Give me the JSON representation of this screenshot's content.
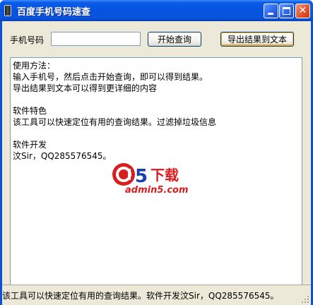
{
  "window": {
    "title": "百度手机号码速查",
    "minimize_icon": "minimize-icon",
    "maximize_icon": "maximize-icon",
    "close_icon": "close-icon",
    "close_glyph": "✕"
  },
  "form": {
    "phone_label": "手机号码",
    "phone_value": "",
    "start_button": "开始查询",
    "export_button": "导出结果到文本"
  },
  "results": {
    "lines": [
      "使用方法：",
      "输入手机号，然后点击开始查询，即可以得到结果。",
      "导出结果到文本可以得到更详细的内容",
      "",
      "软件特色",
      "该工具可以快速定位有用的查询结果。过滤掉垃圾信息",
      "",
      "软件开发",
      "汶Sir，QQ285576545。"
    ]
  },
  "watermark": {
    "logo": "a5",
    "text": "下载",
    "site": "admin5.com",
    "colors": {
      "red": "#d81e1e",
      "blue": "#1c3fae"
    }
  },
  "status": {
    "text": "该工具可以快速定位有用的查询结果。软件开发汶Sir，QQ285576545。"
  },
  "colors": {
    "titlebar": "#0653dd",
    "client": "#ece9d8",
    "close": "#e2502c"
  }
}
